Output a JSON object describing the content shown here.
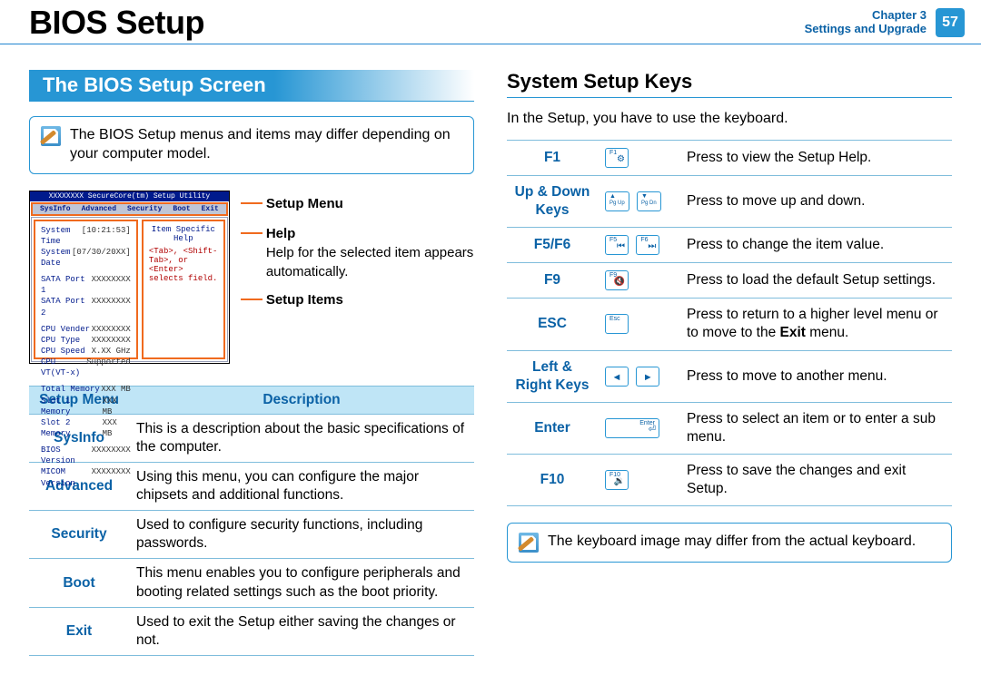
{
  "header": {
    "title": "BIOS Setup",
    "chapter_line1": "Chapter 3",
    "chapter_line2": "Settings and Upgrade",
    "page_number": "57"
  },
  "left": {
    "section_title": "The BIOS Setup Screen",
    "note": "The BIOS Setup menus and items may differ depending on your computer model.",
    "bios": {
      "titlebar": "XXXXXXXX SecureCore(tm) Setup Utility",
      "menus": [
        "SysInfo",
        "Advanced",
        "Security",
        "Boot",
        "Exit"
      ],
      "rows": [
        {
          "k": "System Time",
          "v": "[10:21:53]"
        },
        {
          "k": "System Date",
          "v": "[07/30/20XX]"
        },
        {
          "gap": true
        },
        {
          "k": "SATA Port 1",
          "v": "XXXXXXXX"
        },
        {
          "k": "SATA Port 2",
          "v": "XXXXXXXX"
        },
        {
          "gap": true
        },
        {
          "k": "CPU Vender",
          "v": "XXXXXXXX"
        },
        {
          "k": "CPU Type",
          "v": "XXXXXXXX"
        },
        {
          "k": "CPU Speed",
          "v": "X.XX GHz"
        },
        {
          "k": "CPU VT(VT-x)",
          "v": "Supported"
        },
        {
          "gap": true
        },
        {
          "k": "Total Memory",
          "v": "XXX MB"
        },
        {
          "k": "  Slot 1 Memory",
          "v": "XXX MB"
        },
        {
          "k": "  Slot 2 Memory",
          "v": "XXX MB"
        },
        {
          "gap": true
        },
        {
          "k": "BIOS Version",
          "v": "XXXXXXXX"
        },
        {
          "k": "MICOM Version",
          "v": "XXXXXXXX"
        }
      ],
      "help_title": "Item Specific Help",
      "help_body": "<Tab>, <Shift-Tab>, or <Enter> selects field."
    },
    "callouts": {
      "setup_menu": "Setup Menu",
      "help_title": "Help",
      "help_body": "Help for the selected item appears automatically.",
      "setup_items": "Setup Items"
    },
    "table": {
      "headers": [
        "Setup Menu",
        "Description"
      ],
      "rows": [
        {
          "key": "SysInfo",
          "desc": "This is a description about the basic specifications of the computer."
        },
        {
          "key": "Advanced",
          "desc": "Using this menu, you can configure the major chipsets and additional functions."
        },
        {
          "key": "Security",
          "desc": "Used to configure security functions, including passwords."
        },
        {
          "key": "Boot",
          "desc": "This menu enables you to configure peripherals and booting related settings such as the boot priority."
        },
        {
          "key": "Exit",
          "desc": "Used to exit the Setup either saving the changes or not."
        }
      ]
    }
  },
  "right": {
    "section_title": "System Setup Keys",
    "intro": "In the Setup, you have to use the keyboard.",
    "rows": [
      {
        "label": "F1",
        "desc": "Press to view the Setup Help."
      },
      {
        "label": "Up & Down Keys",
        "desc": "Press to move up and down."
      },
      {
        "label": "F5/F6",
        "desc": "Press to change the item value."
      },
      {
        "label": "F9",
        "desc": "Press to load the default Setup settings."
      },
      {
        "label": "ESC",
        "desc_pre": "Press to return to a higher level menu or to move to the ",
        "desc_bold": "Exit",
        "desc_post": " menu."
      },
      {
        "label": "Left & Right Keys",
        "desc": "Press to move to another menu."
      },
      {
        "label": "Enter",
        "desc": "Press to select an item or to enter a sub menu."
      },
      {
        "label": "F10",
        "desc": "Press to save the changes and exit Setup."
      }
    ],
    "note": "The keyboard image may differ from the actual keyboard."
  },
  "keycaps": {
    "f1": "F1",
    "f5": "F5",
    "f6": "F6",
    "f9": "F9",
    "f10": "F10",
    "esc": "Esc",
    "enter": "Enter",
    "pgup_top": "▲",
    "pgup_sub": "Pg Up",
    "pgdn_top": "▼",
    "pgdn_sub": "Pg Dn",
    "left": "◄",
    "right": "►"
  }
}
